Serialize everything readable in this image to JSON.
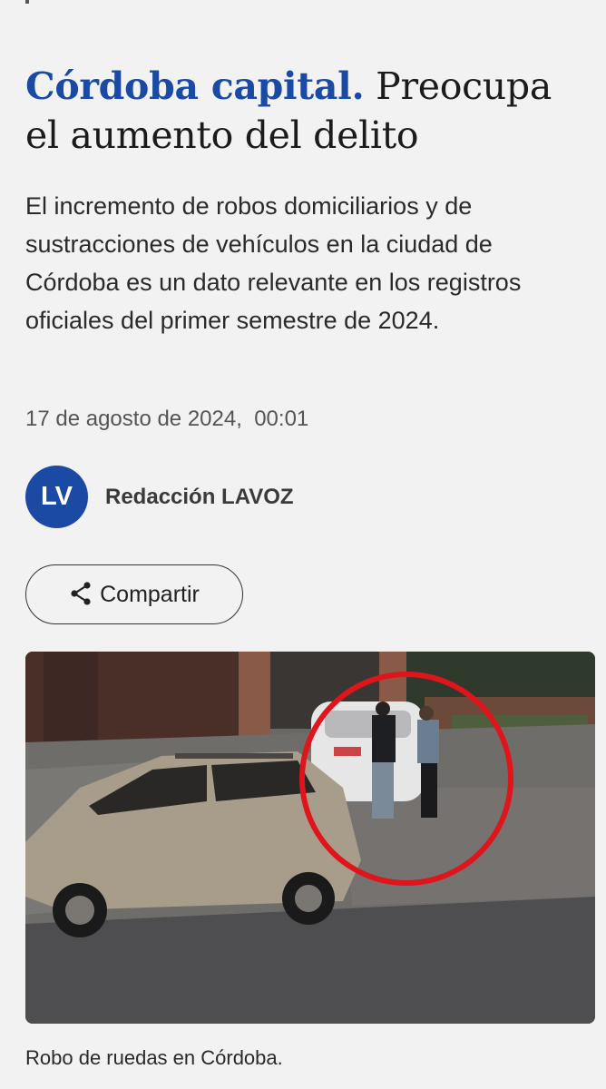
{
  "article": {
    "kicker": "Córdoba capital.",
    "title": "Preocupa el aumento del delito",
    "summary": "El incremento de robos domiciliarios y de sustracciones de vehículos en la ciudad de Córdoba es un dato relevante en los registros oficiales del primer semestre de 2024.",
    "date": "17 de agosto de 2024,  00:01",
    "author": {
      "initials": "LV",
      "name": "Redacción LAVOZ"
    },
    "share": {
      "label": "Compartir",
      "icon": "share-icon"
    },
    "image": {
      "caption": "Robo de ruedas en Córdoba."
    }
  },
  "colors": {
    "accent": "#1a4aa3",
    "background": "#f2f2f2",
    "highlight_circle": "#e0141b"
  }
}
